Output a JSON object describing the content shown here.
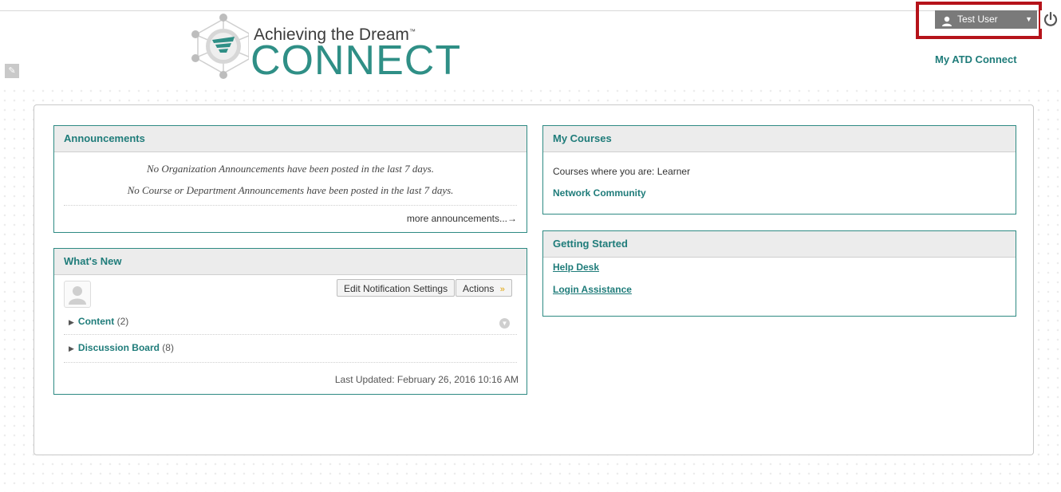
{
  "header": {
    "logo_tagline": "Achieving the Dream",
    "logo_tm": "™",
    "logo_name": "CONNECT",
    "user_name": "Test User",
    "my_atd_link": "My ATD Connect",
    "icons": {
      "edit_mode": "pencil-icon",
      "user": "user-icon",
      "dropdown": "caret-down-icon",
      "logout": "power-icon"
    }
  },
  "announcements": {
    "title": "Announcements",
    "line1": "No Organization Announcements have been posted in the last 7 days.",
    "line2": "No Course or Department Announcements have been posted in the last 7 days.",
    "more_link": "more announcements...→"
  },
  "whats_new": {
    "title": "What's New",
    "edit_notifications": "Edit Notification Settings",
    "actions": "Actions",
    "items": [
      {
        "label": "Content",
        "count": "(2)"
      },
      {
        "label": "Discussion Board",
        "count": "(8)"
      }
    ],
    "last_updated": "Last Updated: February 26, 2016 10:16 AM"
  },
  "my_courses": {
    "title": "My Courses",
    "role_text": "Courses where you are: Learner",
    "course": "Network Community"
  },
  "getting_started": {
    "title": "Getting Started",
    "links": [
      "Help Desk",
      "Login Assistance"
    ]
  },
  "colors": {
    "accent": "#1f7c7a",
    "border": "#2e8a83",
    "highlight": "#b5131a",
    "user_menu_bg": "#7a7a7a"
  }
}
